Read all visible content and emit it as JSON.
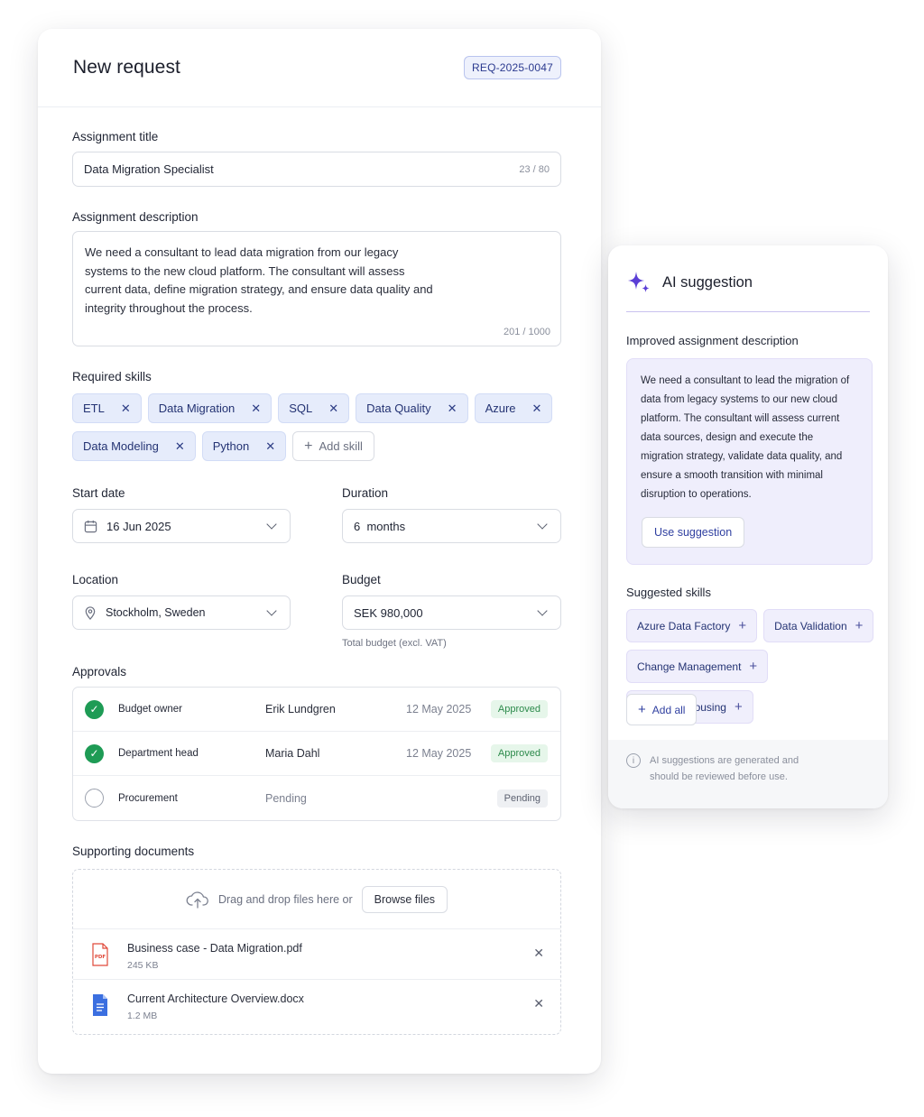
{
  "form": {
    "title": "New request",
    "request_id": "REQ-2025-0047",
    "assignment_title": {
      "label": "Assignment title",
      "value": "Data Migration Specialist",
      "counter": "23 / 80"
    },
    "assignment_description": {
      "label": "Assignment description",
      "value": "We need a consultant to lead data migration from our legacy systems to the new cloud platform. The consultant will assess current data, define migration strategy, and ensure data quality and integrity throughout the process.",
      "counter": "201 / 1000"
    },
    "required_skills": {
      "label": "Required skills",
      "items": [
        "ETL",
        "Data Migration",
        "SQL",
        "Data Quality",
        "Azure",
        "Data Modeling",
        "Python"
      ],
      "remove_glyph": "✕",
      "add_label": "Add skill"
    },
    "start_date": {
      "label": "Start date",
      "value": "16 Jun 2025",
      "icon": "calendar-icon"
    },
    "duration": {
      "label": "Duration",
      "value": "6  months"
    },
    "location": {
      "label": "Location",
      "value": "Stockholm, Sweden",
      "icon": "map-pin-icon"
    },
    "budget": {
      "label": "Budget",
      "value": "SEK 980,000",
      "hint": "Total budget (excl. VAT)"
    },
    "approvals": {
      "label": "Approvals",
      "rows": [
        {
          "role": "Budget owner",
          "person": "Erik Lundgren",
          "date": "12 May 2025",
          "status": "Approved"
        },
        {
          "role": "Department head",
          "person": "Maria Dahl",
          "date": "12 May 2025",
          "status": "Approved"
        },
        {
          "role": "Procurement",
          "person": "Pending",
          "date": "",
          "status": "Pending"
        }
      ]
    },
    "documents": {
      "label": "Supporting documents",
      "drop_text": "Drag and drop files here or",
      "browse_label": "Browse files",
      "files": [
        {
          "name": "Business case - Data Migration.pdf",
          "size": "245 KB",
          "icon": "pdf-file-icon"
        },
        {
          "name": "Current Architecture Overview.docx",
          "size": "1.2 MB",
          "icon": "doc-file-icon"
        }
      ]
    }
  },
  "ai": {
    "title": "AI suggestion",
    "improved_label": "Improved assignment description",
    "improved_text": "We need a consultant to lead the migration of data from legacy systems to our new cloud platform. The consultant will assess current data sources, design and execute the migration strategy, validate data quality, and ensure a smooth transition with minimal disruption to operations.",
    "use_label": "Use suggestion",
    "suggested_label": "Suggested skills",
    "suggested_skills": [
      "Azure Data Factory",
      "Data Validation",
      "Change Management",
      "Data Warehousing"
    ],
    "add_all_label": "Add all",
    "footer_note": "AI suggestions are generated and should be reviewed before use."
  },
  "colors": {
    "accent": "#2f3fa0",
    "chip_bg": "#e6ecfb",
    "ai_accent": "#5b3fd6",
    "approved": "#1e9b55"
  }
}
